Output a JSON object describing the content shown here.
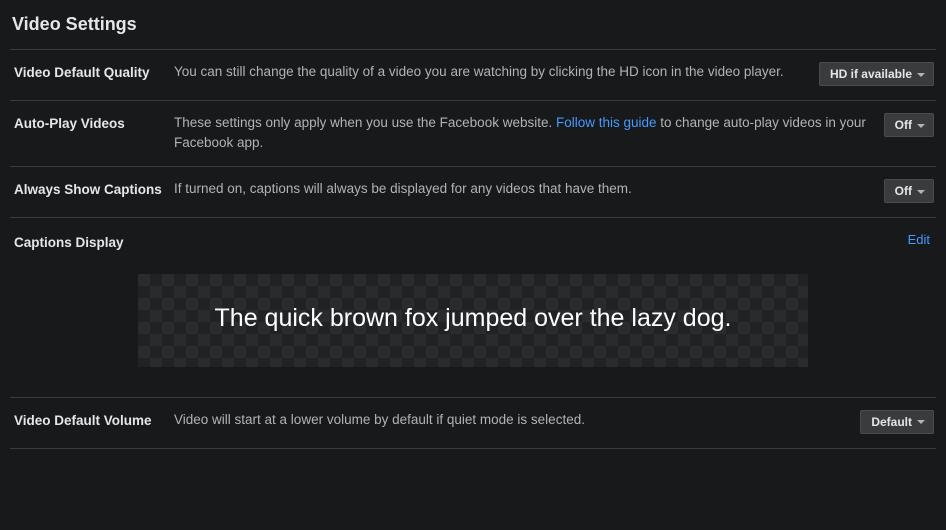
{
  "title": "Video Settings",
  "rows": {
    "quality": {
      "label": "Video Default Quality",
      "desc": "You can still change the quality of a video you are watching by clicking the HD icon in the video player.",
      "value": "HD if available"
    },
    "autoplay": {
      "label": "Auto-Play Videos",
      "desc_pre": "These settings only apply when you use the Facebook website. ",
      "link": "Follow this guide",
      "desc_post": " to change auto-play videos in your Facebook app.",
      "value": "Off"
    },
    "captions_always": {
      "label": "Always Show Captions",
      "desc": "If turned on, captions will always be displayed for any videos that have them.",
      "value": "Off"
    },
    "captions_display": {
      "label": "Captions Display",
      "edit": "Edit",
      "sample": "The quick brown fox jumped over the lazy dog."
    },
    "volume": {
      "label": "Video Default Volume",
      "desc": "Video will start at a lower volume by default if quiet mode is selected.",
      "value": "Default"
    }
  }
}
